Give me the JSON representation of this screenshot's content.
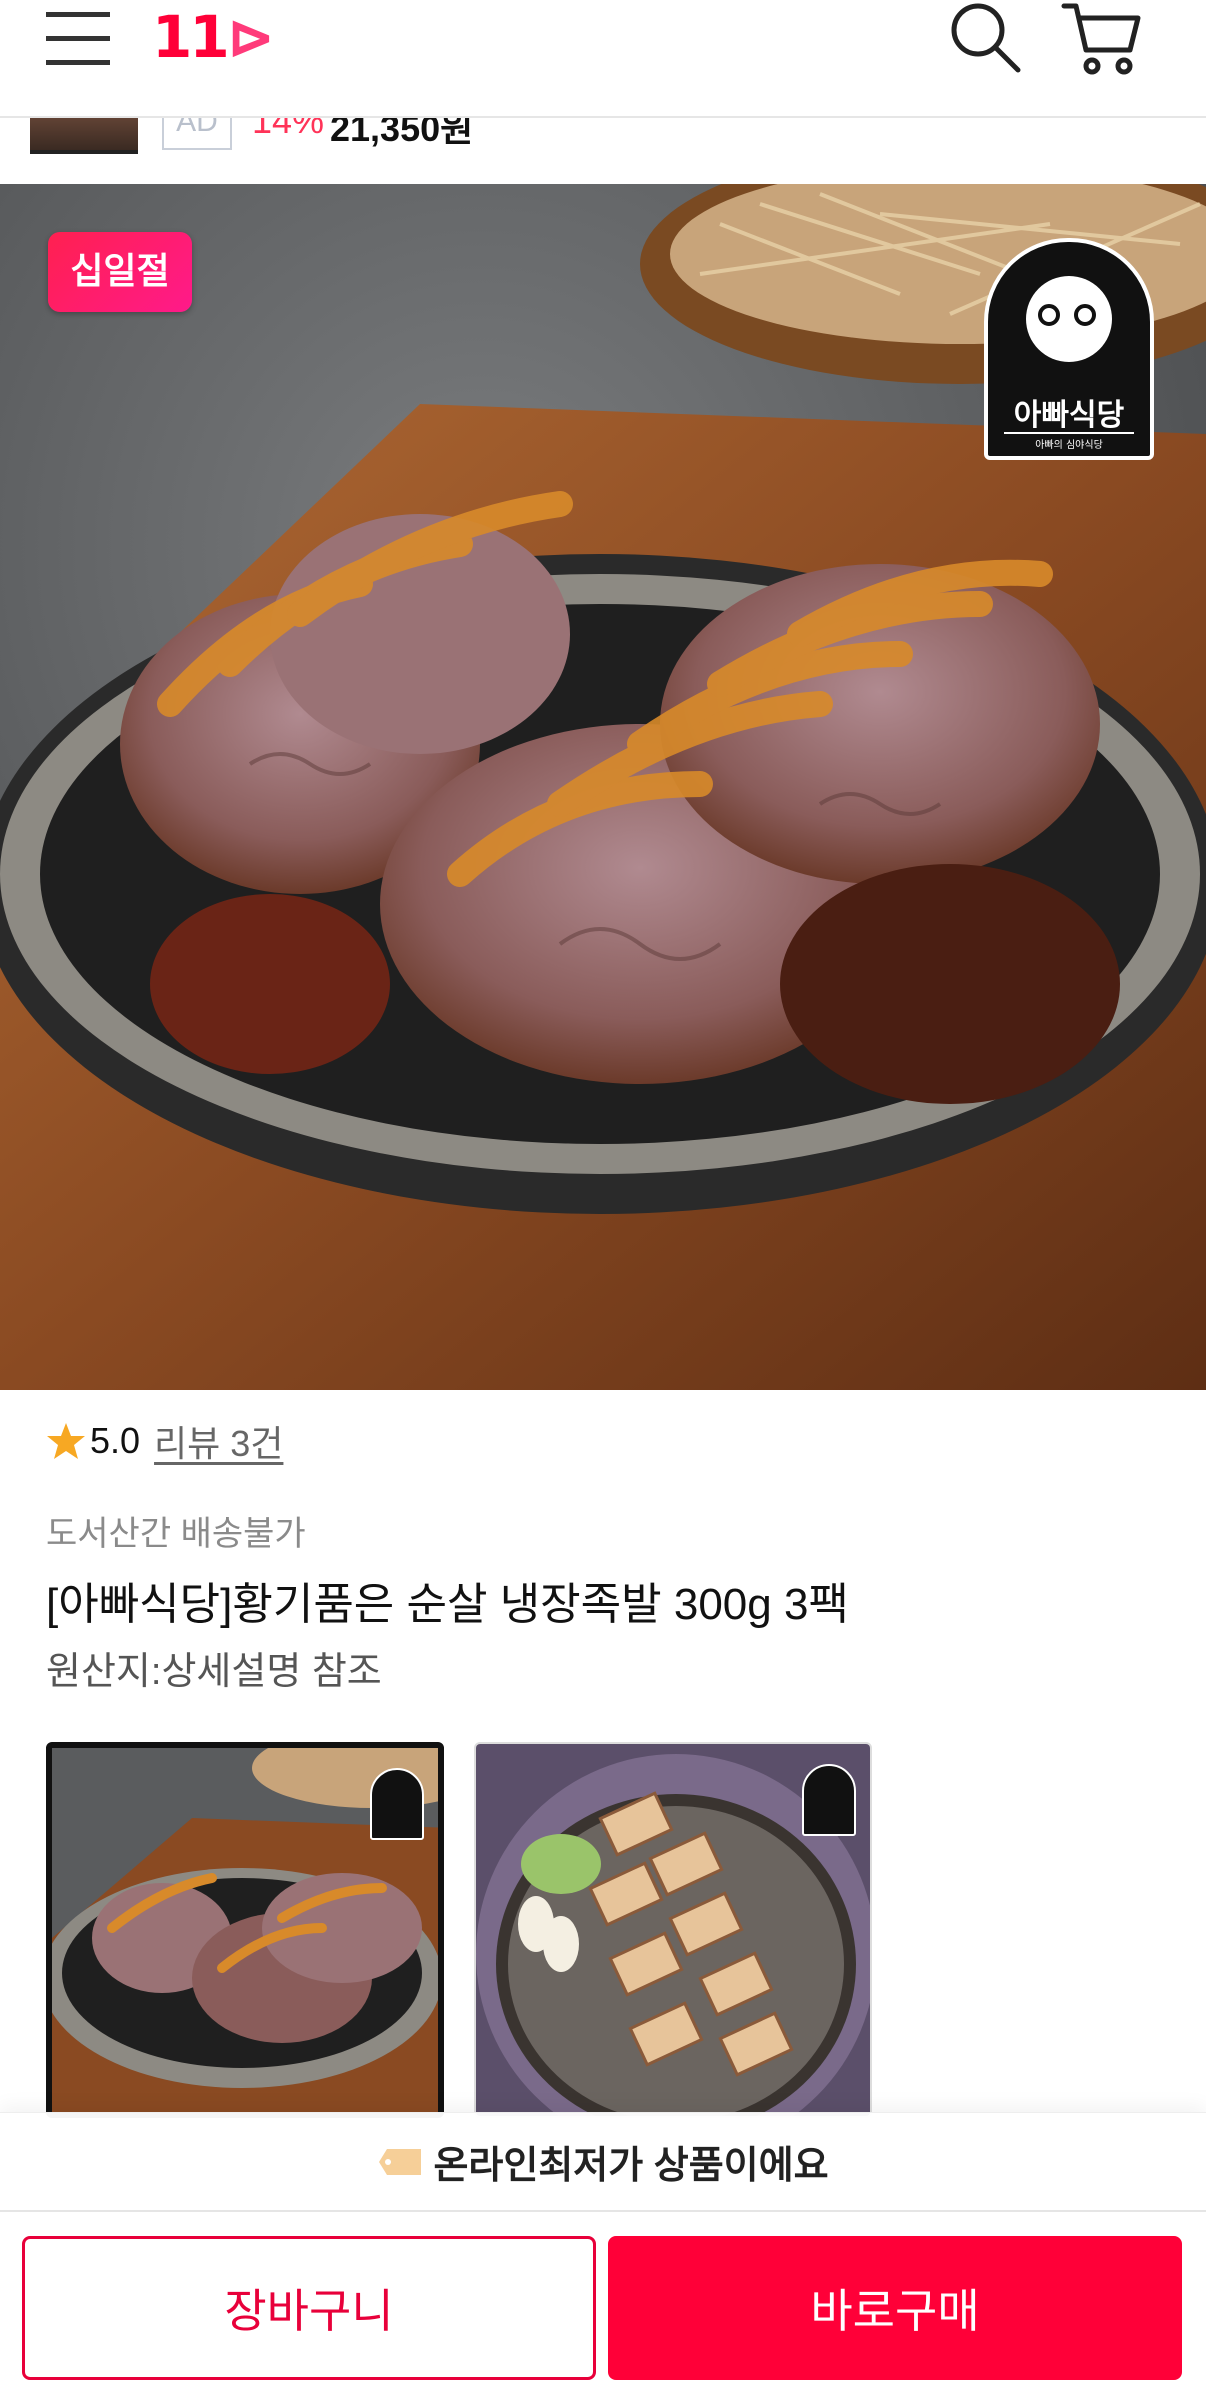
{
  "header": {
    "logo_text": "11",
    "logo_arrow": "⊳",
    "icons": [
      "menu-icon",
      "search-icon",
      "cart-icon"
    ]
  },
  "mini_bar": {
    "ad_label": "AD",
    "discount": "14%",
    "price": "21,350원"
  },
  "hero": {
    "badge": "십일절",
    "brand_name": "아빠식당",
    "brand_sub": "아빠의 심야식당"
  },
  "product": {
    "rating": "5.0",
    "review_link": "리뷰 3건",
    "shipping_notice": "도서산간 배송불가",
    "title": "[아빠식당]황기품은 순살 냉장족발 300g 3팩",
    "origin": "원산지:상세설명 참조"
  },
  "banner": {
    "text": "온라인최저가 상품이에요"
  },
  "actions": {
    "cart_label": "장바구니",
    "buy_label": "바로구매"
  },
  "colors": {
    "brand_red": "#ff0038",
    "star": "#f7a823"
  }
}
